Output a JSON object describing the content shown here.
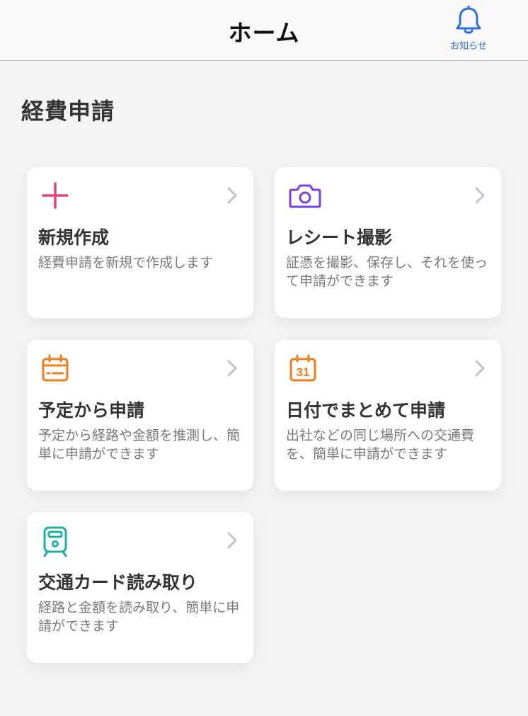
{
  "header": {
    "title": "ホーム",
    "notification_label": "お知らせ",
    "notification_icon": "bell-icon"
  },
  "section": {
    "title": "経費申請"
  },
  "colors": {
    "accent_blue": "#2f6fe0",
    "pink": "#e0457b",
    "purple": "#7b3fe4",
    "orange": "#f07c1a",
    "teal": "#1bb1a3",
    "chevron": "#c2c2d0"
  },
  "cards": [
    {
      "icon": "plus-icon",
      "title": "新規作成",
      "description": "経費申請を新規で作成します"
    },
    {
      "icon": "camera-icon",
      "title": "レシート撮影",
      "description": "証憑を撮影、保存し、それを使って申請ができます"
    },
    {
      "icon": "calendar-icon",
      "title": "予定から申請",
      "description": "予定から経路や金額を推測し、簡単に申請ができます"
    },
    {
      "icon": "calendar-31-icon",
      "title": "日付でまとめて申請",
      "description": "出社などの同じ場所への交通費を、簡単に申請ができます",
      "icon_text": "31"
    },
    {
      "icon": "train-icon",
      "title": "交通カード読み取り",
      "description": "経路と金額を読み取り、簡単に申請ができます"
    }
  ]
}
